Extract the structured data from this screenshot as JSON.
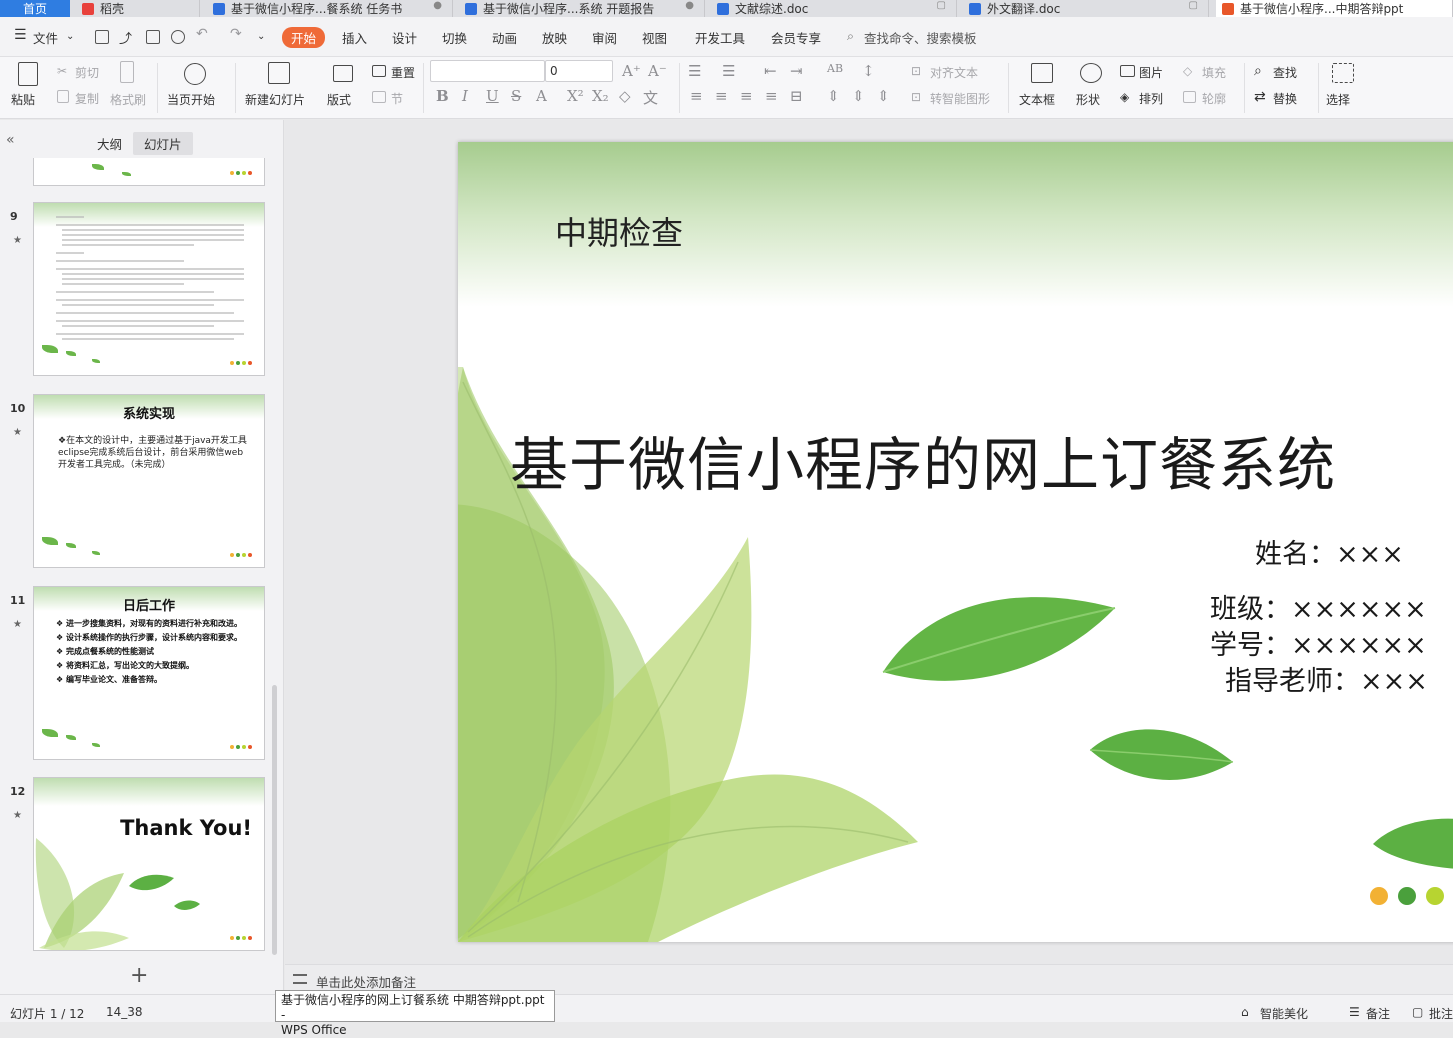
{
  "tabs": [
    {
      "label": "首页",
      "type": "home"
    },
    {
      "label": "稻壳",
      "type": "docer"
    },
    {
      "label": "基于微信小程序...餐系统 任务书",
      "type": "doc"
    },
    {
      "label": "基于微信小程序...系统 开题报告",
      "type": "doc"
    },
    {
      "label": "文献综述.doc",
      "type": "doc"
    },
    {
      "label": "外文翻译.doc",
      "type": "doc"
    },
    {
      "label": "基于微信小程序...中期答辩ppt",
      "type": "ppt",
      "active": true
    }
  ],
  "menu": {
    "file": "文件",
    "items": [
      "开始",
      "插入",
      "设计",
      "切换",
      "动画",
      "放映",
      "审阅",
      "视图",
      "开发工具",
      "会员专享"
    ],
    "search": "查找命令、搜索模板"
  },
  "ribbon": {
    "paste": "粘贴",
    "cut": "剪切",
    "copy": "复制",
    "format_painter": "格式刷",
    "from_current": "当页开始",
    "new_slide": "新建幻灯片",
    "layout": "版式",
    "reset": "重置",
    "section": "节",
    "font_size": "0",
    "align_text": "对齐文本",
    "smart_art": "转智能图形",
    "textbox": "文本框",
    "shapes": "形状",
    "picture": "图片",
    "fill": "填充",
    "arrange": "排列",
    "outline": "轮廓",
    "find": "查找",
    "replace": "替换",
    "select": "选择"
  },
  "panel": {
    "tab_outline": "大纲",
    "tab_slides": "幻灯片"
  },
  "thumbs": [
    {
      "num": "9",
      "title": "",
      "lines": []
    },
    {
      "num": "10",
      "title": "系统实现",
      "text": "❖在本文的设计中，主要通过基于java开发工具eclipse完成系统后台设计，前台采用微信web开发者工具完成。（未完成）"
    },
    {
      "num": "11",
      "title": "日后工作",
      "lines": [
        "❖ 进一步搜集资料，对现有的资料进行补充和改进。",
        "❖ 设计系统操作的执行步骤，设计系统内容和要求。",
        "❖ 完成点餐系统的性能测试",
        "❖ 将资料汇总，写出论文的大致提纲。",
        "❖ 编写毕业论文、准备答辩。"
      ]
    },
    {
      "num": "12",
      "title": "Thank You!"
    }
  ],
  "slide": {
    "heading": "中期检查",
    "title": "基于微信小程序的网上订餐系统",
    "name": "姓名：×××",
    "class": "班级：××××××",
    "student_id": "学号：××××××",
    "advisor": "指导老师：×××"
  },
  "colors": {
    "accent": "#ef6a38",
    "leaf_green": "#6bb64a",
    "dot_orange": "#f2b134",
    "dot_green": "#4aa03c",
    "dot_lime": "#b7d431"
  },
  "notes_placeholder": "单击此处添加备注",
  "status": {
    "slide_counter": "幻灯片 1 / 12",
    "theme": "14_38",
    "smart_beautify": "智能美化",
    "notes": "备注",
    "comments": "批注"
  },
  "tooltip": {
    "line1": "基于微信小程序的网上订餐系统 中期答辩ppt.ppt -",
    "line2": "WPS Office"
  }
}
